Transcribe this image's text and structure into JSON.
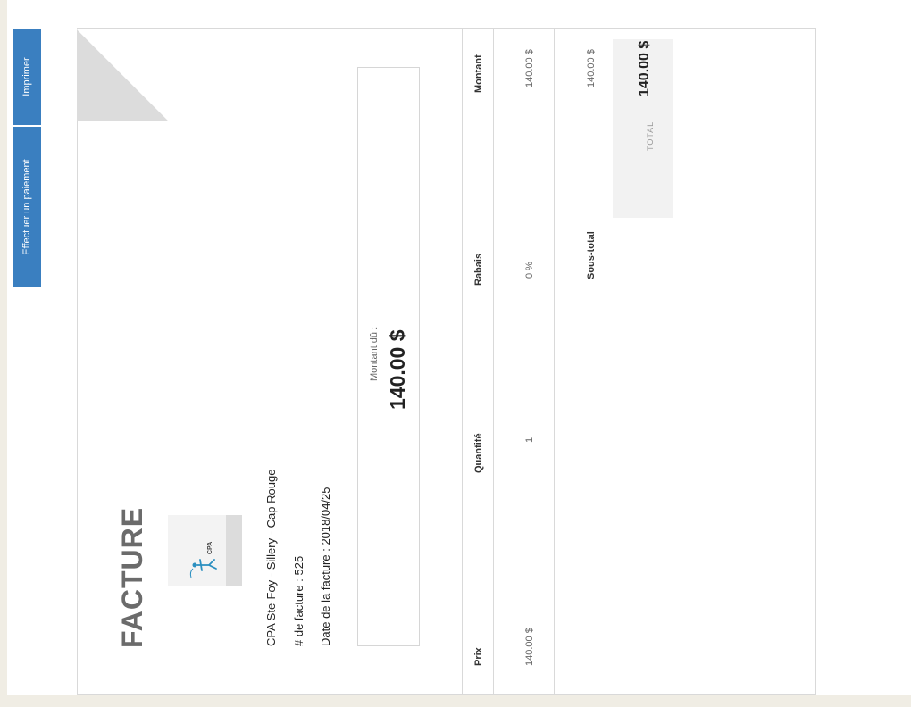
{
  "toolbar": {
    "pay_label": "Effectuer un paiement",
    "print_label": "Imprimer"
  },
  "invoice": {
    "title": "FACTURE",
    "org_name": "CPA Ste-Foy - Sillery - Cap Rouge",
    "invoice_number": "# de facture : 525",
    "invoice_date": "Date de la facture : 2018/04/25",
    "amount_due_label": "Montant dû :",
    "amount_due_value": "140.00 $",
    "logo_text": "CPA"
  },
  "table": {
    "headers": [
      "Prix",
      "Quantité",
      "Rabais",
      "Montant"
    ],
    "rows": [
      {
        "price": "140.00 $",
        "qty": "1",
        "discount": "0 %",
        "amount": "140.00 $"
      }
    ]
  },
  "totals": {
    "subtotal_label": "Sous-total",
    "subtotal_value": "140.00 $",
    "total_label": "TOTAL",
    "total_value": "140.00 $"
  }
}
